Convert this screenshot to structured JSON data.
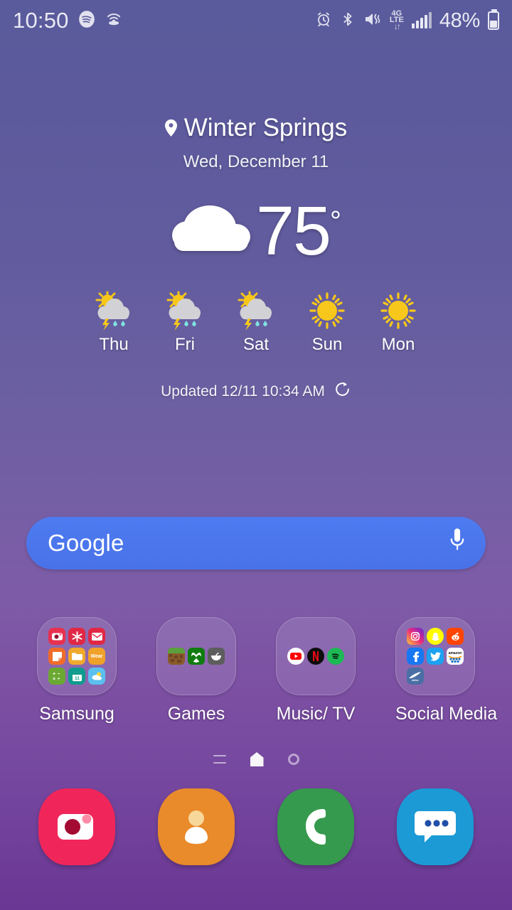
{
  "status_bar": {
    "clock": "10:50",
    "battery_percent": "48%",
    "network": "4G LTE",
    "left_icons": [
      "spotify-icon",
      "hotspot-icon"
    ],
    "right_icons": [
      "alarm-icon",
      "bluetooth-icon",
      "vibrate-icon",
      "lte-icon",
      "signal-bars-icon",
      "battery-icon"
    ],
    "lte_top": "4G",
    "lte_bottom": "LTE"
  },
  "weather": {
    "location": "Winter Springs",
    "date": "Wed, December 11",
    "temperature": "75",
    "degree": "°",
    "condition_icon": "cloudy-icon",
    "updated_text": "Updated 12/11 10:34 AM",
    "refresh_icon": "refresh-icon",
    "forecast": [
      {
        "day": "Thu",
        "icon": "sun-cloud-thunder-rain-icon"
      },
      {
        "day": "Fri",
        "icon": "sun-cloud-thunder-rain-icon"
      },
      {
        "day": "Sat",
        "icon": "sun-cloud-thunder-rain-icon"
      },
      {
        "day": "Sun",
        "icon": "sun-icon"
      },
      {
        "day": "Mon",
        "icon": "sun-icon"
      }
    ]
  },
  "search": {
    "label": "Google",
    "mic_icon": "microphone-icon",
    "bar_color": "#4d7bf0"
  },
  "folders": [
    {
      "label": "Samsung",
      "apps": [
        {
          "name": "Camera",
          "glyph": "◉",
          "bg": "#e8314f"
        },
        {
          "name": "SmartThings",
          "glyph": "✱",
          "bg": "#e02845"
        },
        {
          "name": "Email",
          "glyph": "✉",
          "bg": "#e02845"
        },
        {
          "name": "Notes",
          "glyph": "◤",
          "bg": "#ef6c2a"
        },
        {
          "name": "My Files",
          "glyph": "▬",
          "bg": "#f0a92c"
        },
        {
          "name": "Wear",
          "glyph": "Wear",
          "bg": "#f0a12a"
        },
        {
          "name": "Calculator",
          "glyph": "÷",
          "bg": "#6aa832"
        },
        {
          "name": "Calendar",
          "glyph": "11",
          "bg": "#0f9b8e"
        },
        {
          "name": "Weather",
          "glyph": "☁",
          "bg": "#5bc0f0"
        }
      ]
    },
    {
      "label": "Games",
      "apps": [
        {
          "name": "Minecraft",
          "glyph": "▦",
          "bg": "#7a5c34"
        },
        {
          "name": "Xbox",
          "glyph": "✕",
          "bg": "#107c10"
        },
        {
          "name": "Game",
          "glyph": "◕",
          "bg": "#5d5d5d"
        }
      ]
    },
    {
      "label": "Music/ TV",
      "apps": [
        {
          "name": "YouTube",
          "glyph": "▶",
          "bg": "#ffffff"
        },
        {
          "name": "Netflix",
          "glyph": "N",
          "bg": "#0d0d0d"
        },
        {
          "name": "Spotify",
          "glyph": "♫",
          "bg": "#1db954"
        }
      ]
    },
    {
      "label": "Social Media",
      "apps": [
        {
          "name": "Instagram",
          "glyph": "◎",
          "bg": "#c13584"
        },
        {
          "name": "Snapchat",
          "glyph": "◑",
          "bg": "#fffc00"
        },
        {
          "name": "Reddit",
          "glyph": "◉",
          "bg": "#ff4500"
        },
        {
          "name": "Facebook",
          "glyph": "f",
          "bg": "#1877f2"
        },
        {
          "name": "Twitter",
          "glyph": "◔",
          "bg": "#1da1f2"
        },
        {
          "name": "Amazon",
          "glyph": "a",
          "bg": "#ffffff"
        },
        {
          "name": "Airline",
          "glyph": "✈",
          "bg": "#4a6fa5"
        }
      ]
    }
  ],
  "page_indicator": {
    "items": [
      "menu-lines-icon",
      "home-page-icon",
      "page-circle-icon"
    ],
    "current": 1
  },
  "dock": [
    {
      "name": "Camera",
      "icon": "camera-icon",
      "bg": "#f0265a"
    },
    {
      "name": "Contacts",
      "icon": "contacts-icon",
      "bg": "#e98a2b"
    },
    {
      "name": "Phone",
      "icon": "phone-icon",
      "bg": "#359a4d"
    },
    {
      "name": "Messages",
      "icon": "messages-icon",
      "bg": "#1b9ad6"
    }
  ]
}
